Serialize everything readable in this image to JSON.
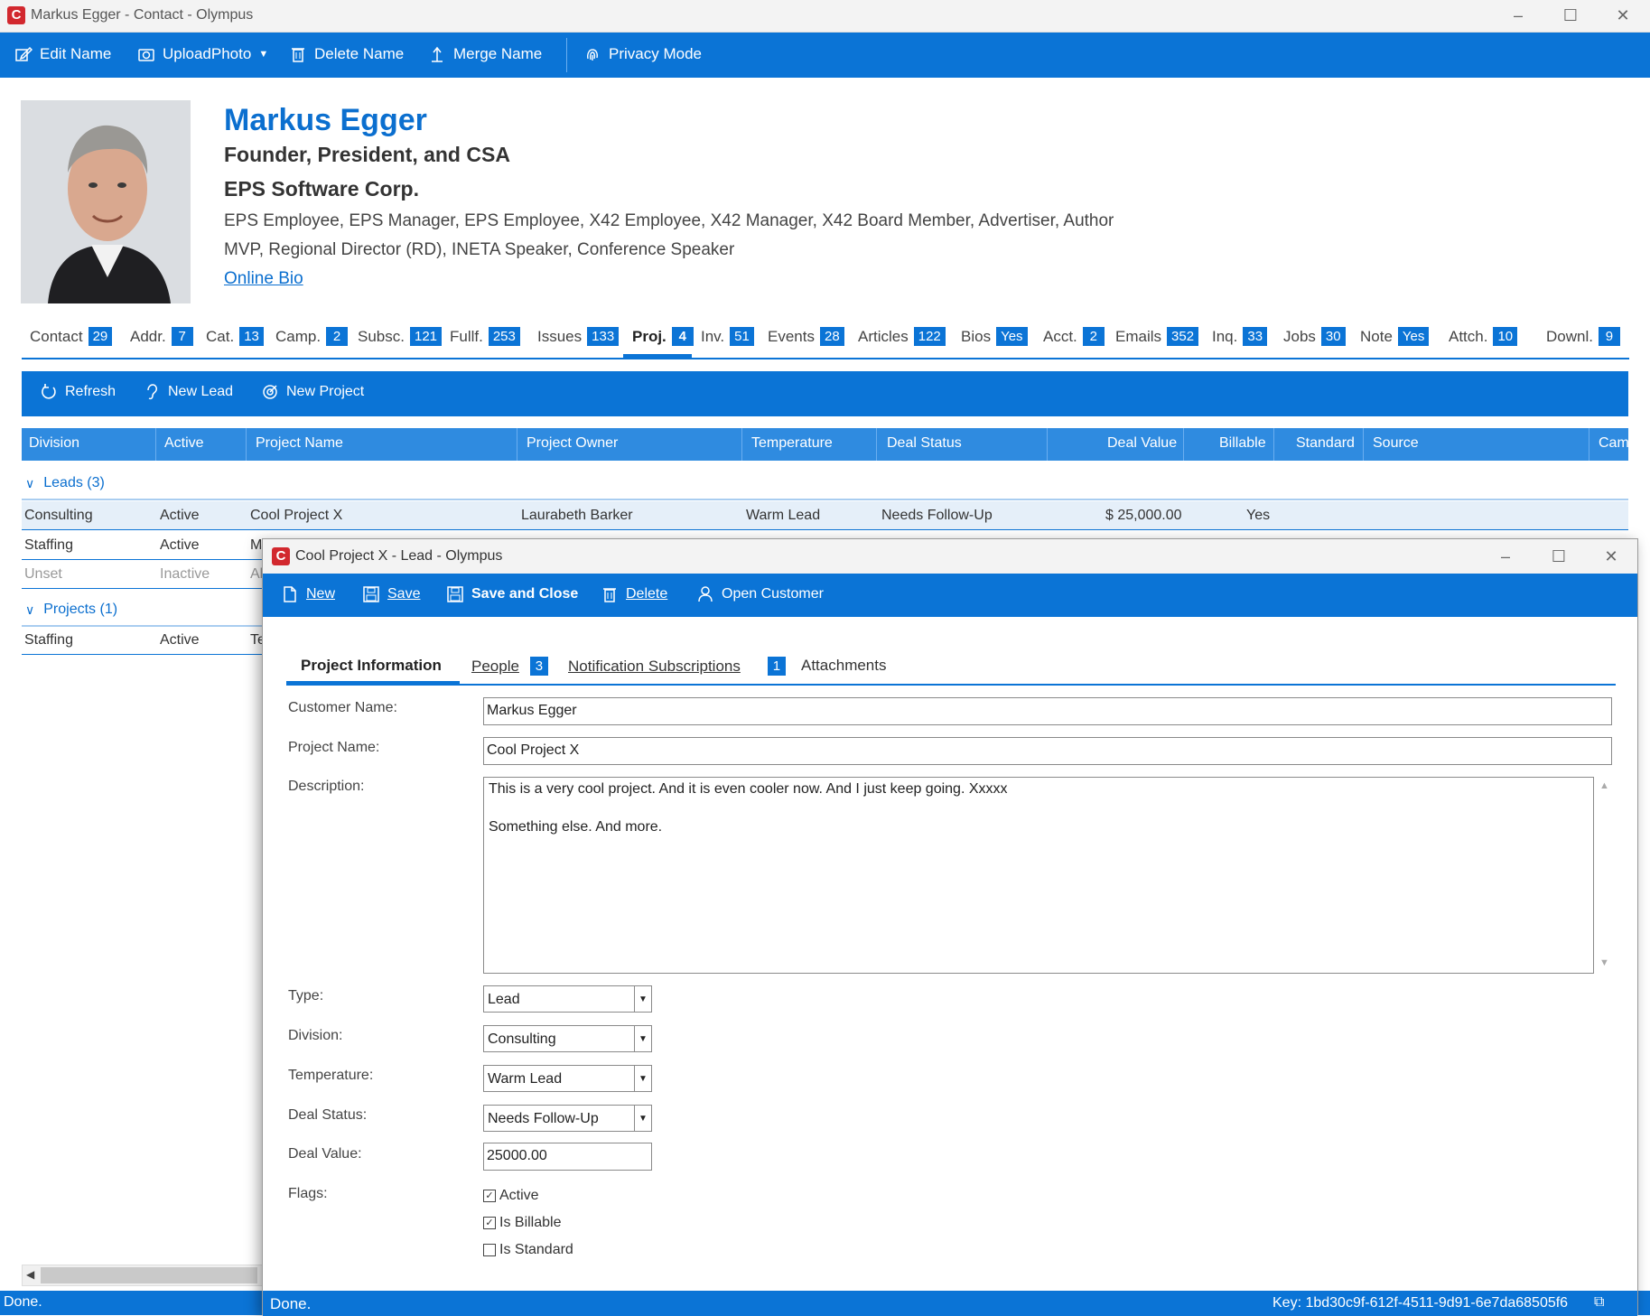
{
  "window": {
    "title": "Markus Egger - Contact - Olympus",
    "logo_letter": "C"
  },
  "toolbar": {
    "edit_name": "Edit Name",
    "upload_photo": "UploadPhoto",
    "delete_name": "Delete Name",
    "merge_name": "Merge Name",
    "privacy_mode": "Privacy Mode"
  },
  "contact": {
    "name": "Markus Egger",
    "title": "Founder, President, and CSA",
    "company": "EPS Software Corp.",
    "categories_line1": "EPS Employee, EPS Manager, EPS Employee, X42 Employee, X42 Manager, X42 Board Member, Advertiser, Author",
    "categories_line2": "MVP, Regional Director (RD), INETA Speaker, Conference Speaker",
    "online_bio": "Online Bio"
  },
  "contact_tabs": [
    {
      "label": "Contact",
      "count": "29"
    },
    {
      "label": "Addr.",
      "count": "7"
    },
    {
      "label": "Cat.",
      "count": "13"
    },
    {
      "label": "Camp.",
      "count": "2"
    },
    {
      "label": "Subsc.",
      "count": "121"
    },
    {
      "label": "Fullf.",
      "count": "253"
    },
    {
      "label": "Issues",
      "count": "133"
    },
    {
      "label": "Proj.",
      "count": "4"
    },
    {
      "label": "Inv.",
      "count": "51"
    },
    {
      "label": "Events",
      "count": "28"
    },
    {
      "label": "Articles",
      "count": "122"
    },
    {
      "label": "Bios",
      "count": "Yes"
    },
    {
      "label": "Acct.",
      "count": "2"
    },
    {
      "label": "Emails",
      "count": "352"
    },
    {
      "label": "Inq.",
      "count": "33"
    },
    {
      "label": "Jobs",
      "count": "30"
    },
    {
      "label": "Note",
      "count": "Yes"
    },
    {
      "label": "Attch.",
      "count": "10"
    },
    {
      "label": "Downl.",
      "count": "9"
    }
  ],
  "grid_toolbar": {
    "refresh": "Refresh",
    "new_lead": "New Lead",
    "new_project": "New Project"
  },
  "grid": {
    "columns": [
      "Division",
      "Active",
      "Project Name",
      "Project Owner",
      "Temperature",
      "Deal Status",
      "Deal Value",
      "Billable",
      "Standard",
      "Source",
      "Cam"
    ],
    "group_leads": "Leads (3)",
    "group_projects": "Projects (1)",
    "rows": [
      {
        "division": "Consulting",
        "active": "Active",
        "project": "Cool Project X",
        "owner": "Laurabeth Barker",
        "temperature": "Warm Lead",
        "deal_status": "Needs Follow-Up",
        "deal_value": "$ 25,000.00",
        "billable": "Yes"
      },
      {
        "division": "Staffing",
        "active": "Active",
        "project": "M"
      },
      {
        "division": "Unset",
        "active": "Inactive",
        "project": "Al"
      }
    ],
    "project_rows": [
      {
        "division": "Staffing",
        "active": "Active",
        "project": "Te"
      }
    ]
  },
  "main_status": {
    "text": "Done."
  },
  "dialog": {
    "title": "Cool Project X - Lead - Olympus",
    "toolbar": {
      "new": "New",
      "save": "Save",
      "save_close": "Save and Close",
      "delete": "Delete",
      "open_customer": "Open Customer"
    },
    "tabs": {
      "project_information": "Project Information",
      "people": "People",
      "people_count": "3",
      "notification_subscriptions": "Notification Subscriptions",
      "notification_count": "1",
      "attachments": "Attachments"
    },
    "fields": {
      "customer_name_label": "Customer Name:",
      "customer_name": "Markus Egger",
      "project_name_label": "Project Name:",
      "project_name": "Cool Project X",
      "description_label": "Description:",
      "description_line1": "This is a very cool project. And it is even cooler now. And I just keep going. Xxxxx",
      "description_line2": "Something else. And more.",
      "type_label": "Type:",
      "type": "Lead",
      "division_label": "Division:",
      "division": "Consulting",
      "temperature_label": "Temperature:",
      "temperature": "Warm Lead",
      "deal_status_label": "Deal Status:",
      "deal_status": "Needs Follow-Up",
      "deal_value_label": "Deal Value:",
      "deal_value": "25000.00",
      "flags_label": "Flags:",
      "flag_active": "Active",
      "flag_billable": "Is Billable",
      "flag_standard": "Is Standard"
    },
    "status": {
      "text": "Done.",
      "key": "Key: 1bd30c9f-612f-4511-9d91-6e7da68505f6"
    }
  },
  "colors": {
    "accent": "#0b74d6",
    "brand": "#d2282e"
  }
}
